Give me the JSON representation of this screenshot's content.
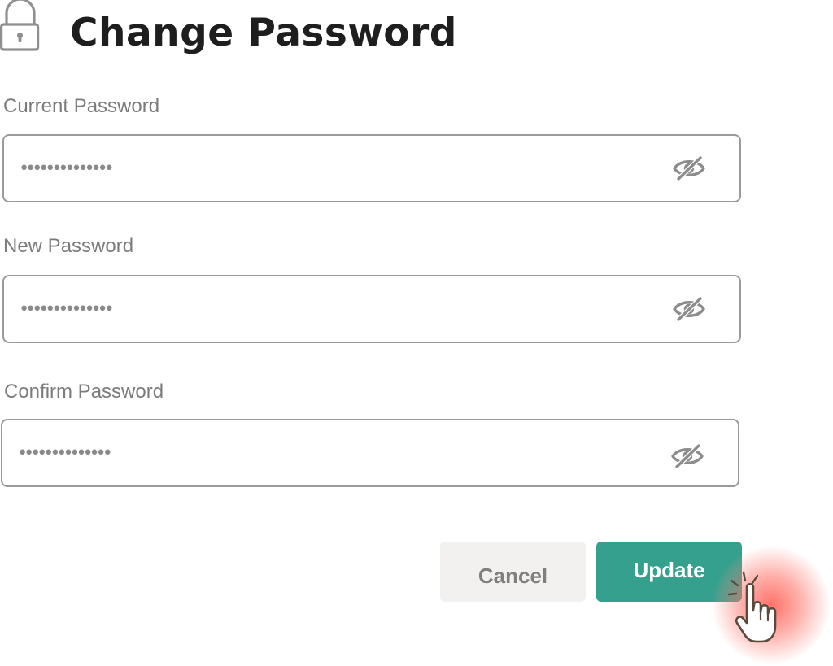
{
  "header": {
    "title": "Change Password",
    "icon": "lock-icon"
  },
  "form": {
    "current_password": {
      "label": "Current Password",
      "value": "••••••••••••••",
      "toggle_icon": "eye-slash-icon"
    },
    "new_password": {
      "label": "New Password",
      "value": "••••••••••••••",
      "toggle_icon": "eye-slash-icon"
    },
    "confirm_password": {
      "label": "Confirm Password",
      "value": "••••••••••••••",
      "toggle_icon": "eye-slash-icon"
    }
  },
  "actions": {
    "cancel_label": "Cancel",
    "update_label": "Update"
  },
  "cursor": {
    "icon": "pointer-hand-icon",
    "state": "clicking"
  },
  "colors": {
    "title": "#1e1e1e",
    "label": "#7b7b7b",
    "field_border": "#9a9a9a",
    "cancel_bg": "#f2f1ef",
    "cancel_text": "#7f7f7f",
    "update_bg": "#35a08e",
    "update_text": "#ffffff",
    "click_highlight": "#ff5a50"
  }
}
